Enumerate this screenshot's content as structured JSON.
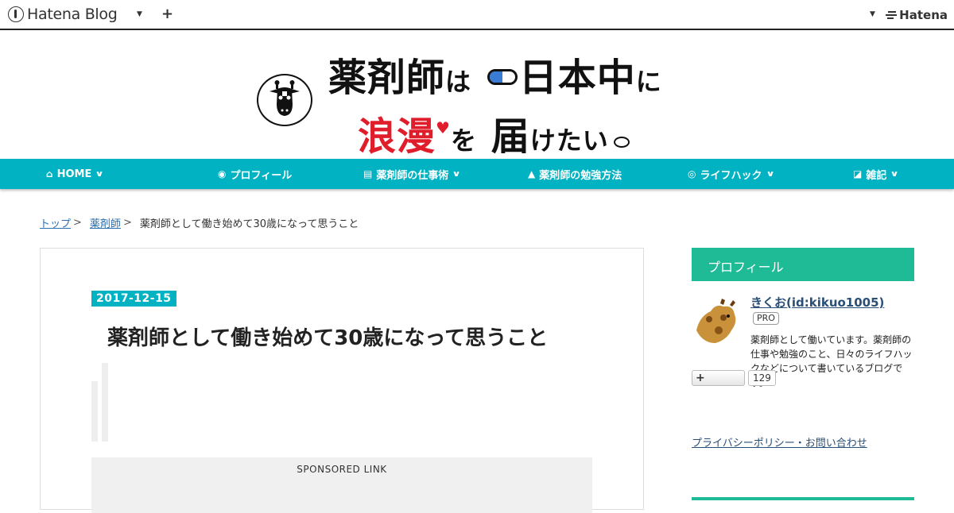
{
  "topbar": {
    "brand": "Hatena Blog",
    "add_label": "+",
    "hatena_label": "Hatena"
  },
  "header": {
    "line1_a": "薬剤師",
    "line1_b": "は",
    "line1_c": "日本中",
    "line1_d": "に",
    "line2_a": "浪漫",
    "line2_b": "を",
    "line2_c": "届",
    "line2_d": "けたい"
  },
  "nav": {
    "items": [
      {
        "icon": "home-icon",
        "label": "HOME",
        "dropdown": true
      },
      {
        "icon": "user-circle-icon",
        "label": "プロフィール",
        "dropdown": false
      },
      {
        "icon": "clipboard-icon",
        "label": "薬剤師の仕事術",
        "dropdown": true
      },
      {
        "icon": "graduation-cap-icon",
        "label": "薬剤師の勉強方法",
        "dropdown": true
      },
      {
        "icon": "gamepad-icon",
        "label": "ライフハック",
        "dropdown": true
      },
      {
        "icon": "note-icon",
        "label": "雑記",
        "dropdown": true
      }
    ]
  },
  "breadcrumb": {
    "home": "トップ",
    "category": "薬剤師",
    "current": "薬剤師として働き始めて30歳になって思うこと"
  },
  "article": {
    "date": "2017-12-15",
    "title": "薬剤師として働き始めて30歳になって思うこと",
    "sponsored": "SPONSORED LINK"
  },
  "sidebar": {
    "heading": "プロフィール",
    "name": "きくお(id:kikuo1005)",
    "pro": "PRO",
    "description": "薬剤師として働いています。薬剤師の仕事や勉強のこと、日々のライフハックなどについて書いているブログです。",
    "follow_label": "+",
    "follow_count": "129",
    "link": "プライバシーポリシー・お問い合わせ"
  },
  "colors": {
    "nav": "#00b2c2",
    "sidebar_heading": "#1fbb96",
    "accent_red": "#e01e2b"
  }
}
